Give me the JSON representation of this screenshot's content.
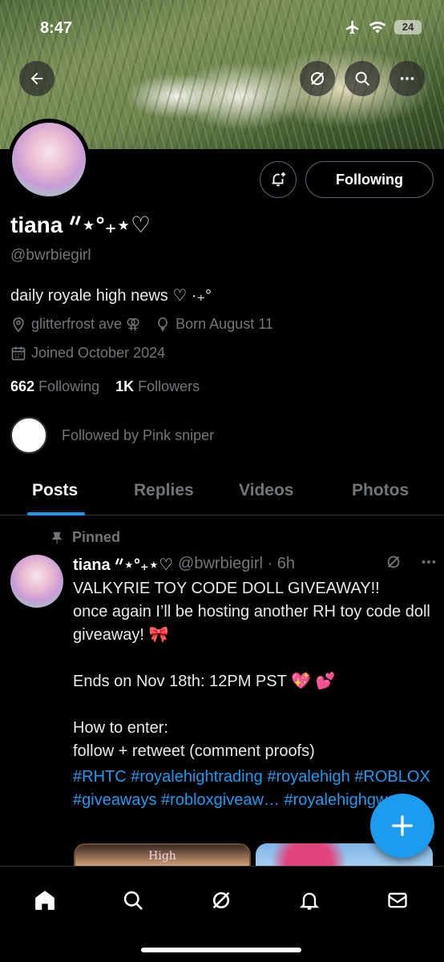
{
  "status": {
    "time": "8:47",
    "battery": "24"
  },
  "profile": {
    "name": "tiana ᐥ⋆°₊⋆♡",
    "handle": "@bwrbiegirl",
    "bio": "daily royale high news ♡ ·₊°",
    "location": "glitterfrost ave ⚢",
    "birthday": "Born August 11",
    "joined": "Joined October 2024",
    "following_count": "662",
    "following_label": "Following",
    "followers_count": "1K",
    "followers_label": "Followers",
    "followed_by": "Followed by Pink sniper",
    "follow_button": "Following"
  },
  "tabs": [
    {
      "label": "Posts"
    },
    {
      "label": "Replies"
    },
    {
      "label": "Videos"
    },
    {
      "label": "Photos"
    }
  ],
  "post": {
    "pinned_label": "Pinned",
    "author": "tiana ᐥ⋆°₊⋆♡",
    "handle_time": "@bwrbiegirl · 6h",
    "body": "VALKYRIE TOY CODE DOLL GIVEAWAY!!\nonce again I’ll be hosting another RH toy code doll giveaway! 🎀\n\nEnds on Nov 18th: 12PM PST 💖 💕\n\nHow to enter:\nfollow + retweet (comment proofs)",
    "hashtags": "#RHTC #royalehightrading #royalehigh #ROBLOX #giveaways #robloxgiveaw… #royalehighgw",
    "media_label": "High"
  },
  "colors": {
    "accent": "#1d9bf0",
    "muted": "#71767b",
    "background": "#000000"
  },
  "icons": [
    "back-arrow-icon",
    "grok-icon",
    "search-icon",
    "more-icon",
    "bell-plus-icon",
    "location-icon",
    "balloon-icon",
    "calendar-icon",
    "pin-icon",
    "plus-icon",
    "home-icon",
    "bell-icon",
    "mail-icon"
  ]
}
